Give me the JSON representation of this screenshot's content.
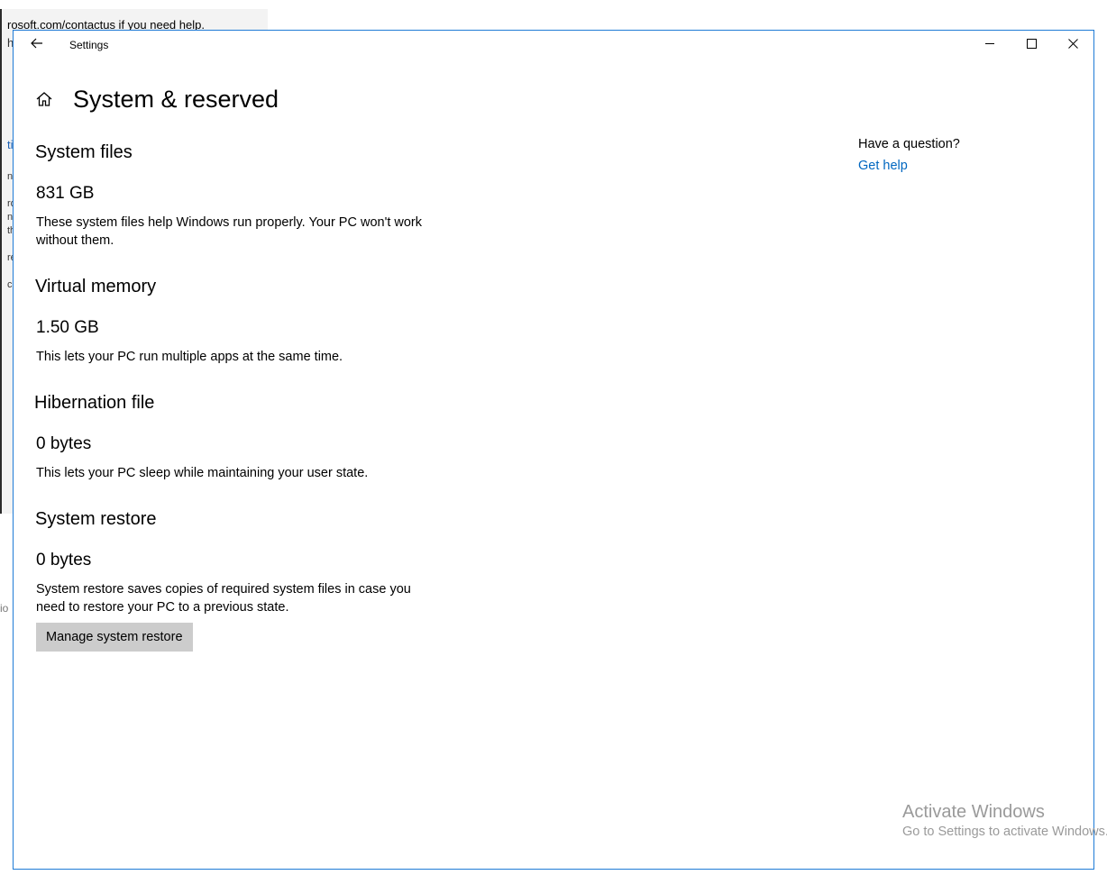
{
  "background_window": {
    "url_text": "rosoft.com/contactus if you need help.",
    "fragments": [
      "ho",
      "tio",
      "nt",
      "ro",
      "nd",
      "th",
      "re",
      "c"
    ],
    "bottom_fragment": "io"
  },
  "window": {
    "title": "Settings",
    "accent_color": "#1f7bd6"
  },
  "page": {
    "title": "System & reserved"
  },
  "sections": [
    {
      "title": "System files",
      "size": "831 GB",
      "description": "These system files help Windows run properly. Your PC won't work without them."
    },
    {
      "title": "Virtual memory",
      "size": "1.50 GB",
      "description": "This lets your PC run multiple apps at the same time."
    },
    {
      "title": "Hibernation file",
      "size": "0 bytes",
      "description": "This lets your PC sleep while maintaining your user state."
    },
    {
      "title": "System restore",
      "size": "0 bytes",
      "description": "System restore saves copies of required system files in case you need to restore your PC to a previous state."
    }
  ],
  "manage_button": {
    "label": "Manage system restore"
  },
  "side_panel": {
    "question": "Have a question?",
    "link": "Get help",
    "link_color": "#0067c0"
  },
  "watermark": {
    "title": "Activate Windows",
    "subtitle": "Go to Settings to activate Windows."
  },
  "icons": {
    "back": "back-arrow-icon",
    "home": "home-icon",
    "minimize": "minimize-icon",
    "maximize": "maximize-icon",
    "close": "close-icon"
  }
}
